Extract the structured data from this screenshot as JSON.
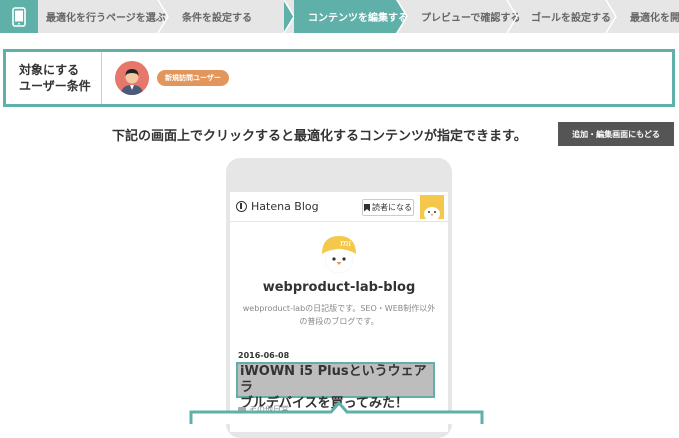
{
  "steps": [
    {
      "label": "最適化を行うページを選ぶ",
      "active": false
    },
    {
      "label": "条件を設定する",
      "active": false
    },
    {
      "label": "コンテンツを編集する",
      "active": true
    },
    {
      "label": "プレビューで確認する",
      "active": false
    },
    {
      "label": "ゴールを設定する",
      "active": false
    },
    {
      "label": "最適化を開始する",
      "active": false
    }
  ],
  "condition": {
    "label_line1": "対象にする",
    "label_line2": "ユーザー条件",
    "badge": "新規訪問ユーザー"
  },
  "instruction": "下記の画面上でクリックすると最適化するコンテンツが指定できます。",
  "back_button": "追加・編集画面にもどる",
  "preview": {
    "logo_text": "Hatena Blog",
    "reader_button": "読者になる",
    "blog_title": "webproduct-lab-blog",
    "blog_desc_line1": "webproduct-labの日記版です。SEO・WEB制作以外",
    "blog_desc_line2": "の普段のブログです。",
    "post_date": "2016-06-08",
    "post_title_line1": "iWOWN i5 Plusというウェアラ",
    "post_title_line2": "ブルデバイスを買ってみた！",
    "post_category": "その他日常"
  },
  "colors": {
    "accent": "#5fb0a9",
    "badge": "#e3965b",
    "button_dark": "#555555",
    "stepbar_bg": "#e6e6e6"
  }
}
